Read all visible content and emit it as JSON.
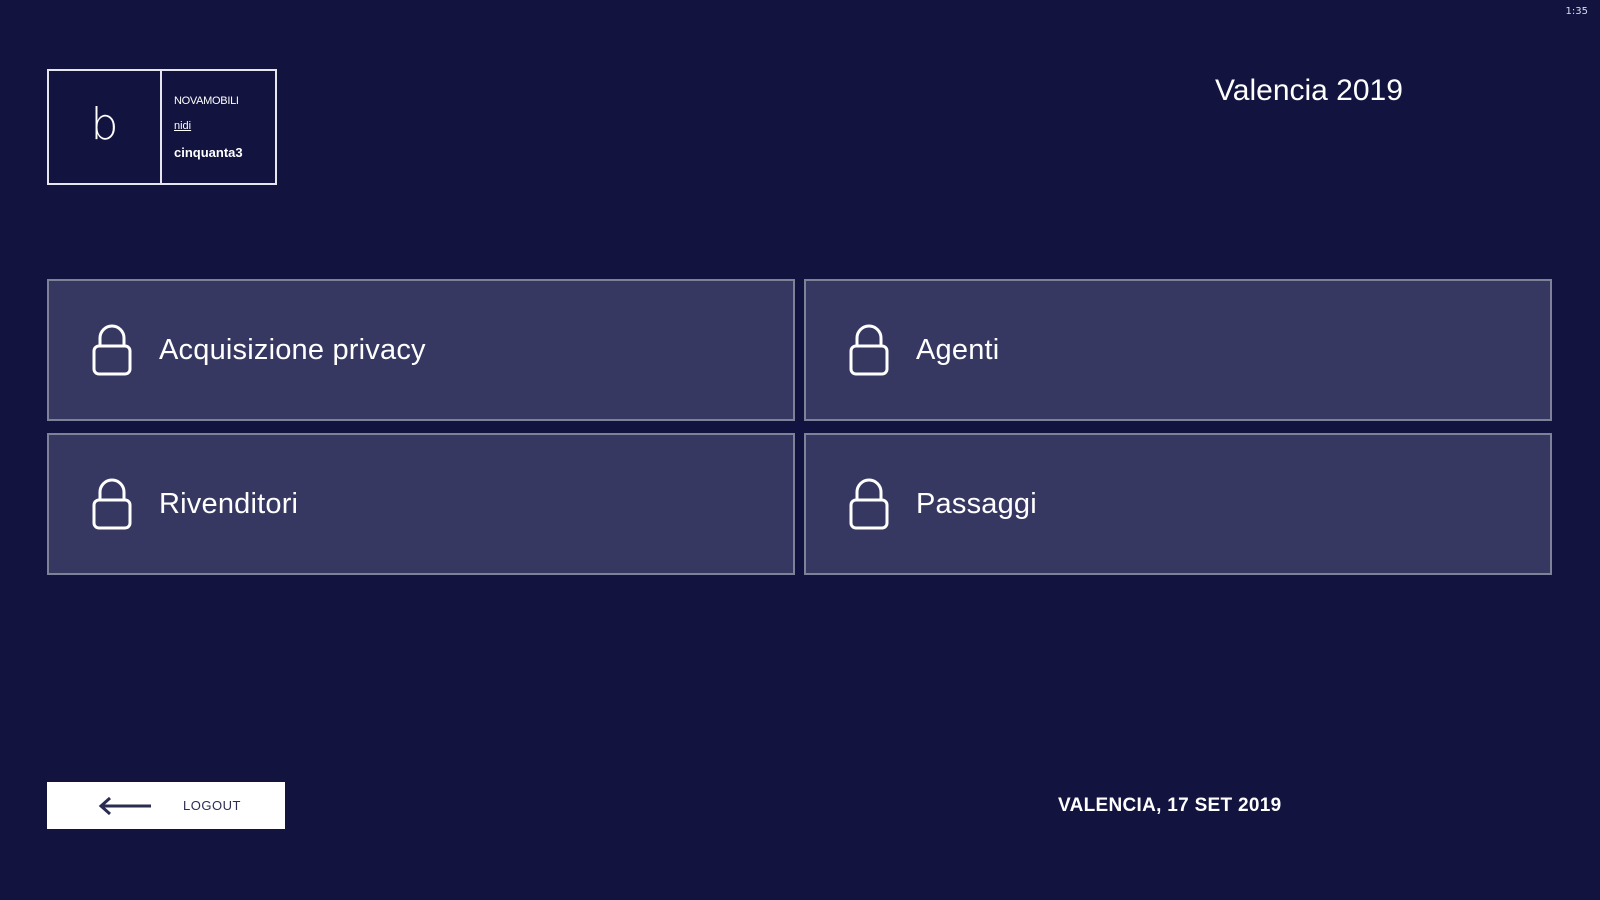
{
  "status_bar": {
    "time": "1:35"
  },
  "logo": {
    "mark": "b",
    "line1": "NOVAMOBILI",
    "line2": "nidi",
    "line3": "cinquanta3"
  },
  "header": {
    "event_title": "Valencia 2019"
  },
  "menu": {
    "tiles": [
      {
        "label": "Acquisizione privacy",
        "icon": "lock-icon"
      },
      {
        "label": "Agenti",
        "icon": "lock-icon"
      },
      {
        "label": "Rivenditori",
        "icon": "lock-icon"
      },
      {
        "label": "Passaggi",
        "icon": "lock-icon"
      }
    ]
  },
  "footer": {
    "logout_label": "LOGOUT",
    "logout_icon": "arrow-left-icon",
    "date_location": "VALENCIA, 17 SET 2019"
  },
  "colors": {
    "background": "#12143f",
    "tile_background": "#363862",
    "tile_border": "#7f8199",
    "text": "#ffffff"
  }
}
